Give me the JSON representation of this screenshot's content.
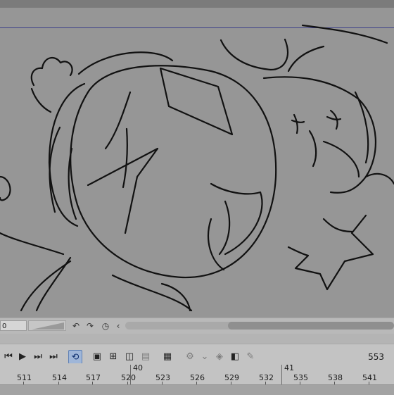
{
  "navigator": {
    "zoom_value": "0",
    "icons": [
      "rotate-left-icon",
      "rotate-right-icon",
      "reset-view-icon",
      "scroll-left-icon"
    ]
  },
  "timeline": {
    "current_frame": "553",
    "second_markers": [
      "40",
      "41"
    ],
    "frame_numbers": [
      "511",
      "514",
      "517",
      "520",
      "523",
      "526",
      "529",
      "532",
      "535",
      "538",
      "541"
    ]
  },
  "toolbar": {
    "buttons": [
      "previous-frame-icon",
      "play-icon",
      "next-frame-icon",
      "last-frame-icon",
      "loop-playback-icon",
      "new-animation-cel-icon",
      "new-animation-folder-icon",
      "onion-skin-icon",
      "light-table-icon",
      "layer-settings-icon",
      "camera-work-icon",
      "keyframe-icon",
      "edit-timeline-icon",
      "pen-icon"
    ]
  },
  "colors": {
    "canvas": "#969696",
    "panel": "#c3c3c3",
    "active_button": "#9fb6d8",
    "frame_border": "#3d3f8a"
  }
}
